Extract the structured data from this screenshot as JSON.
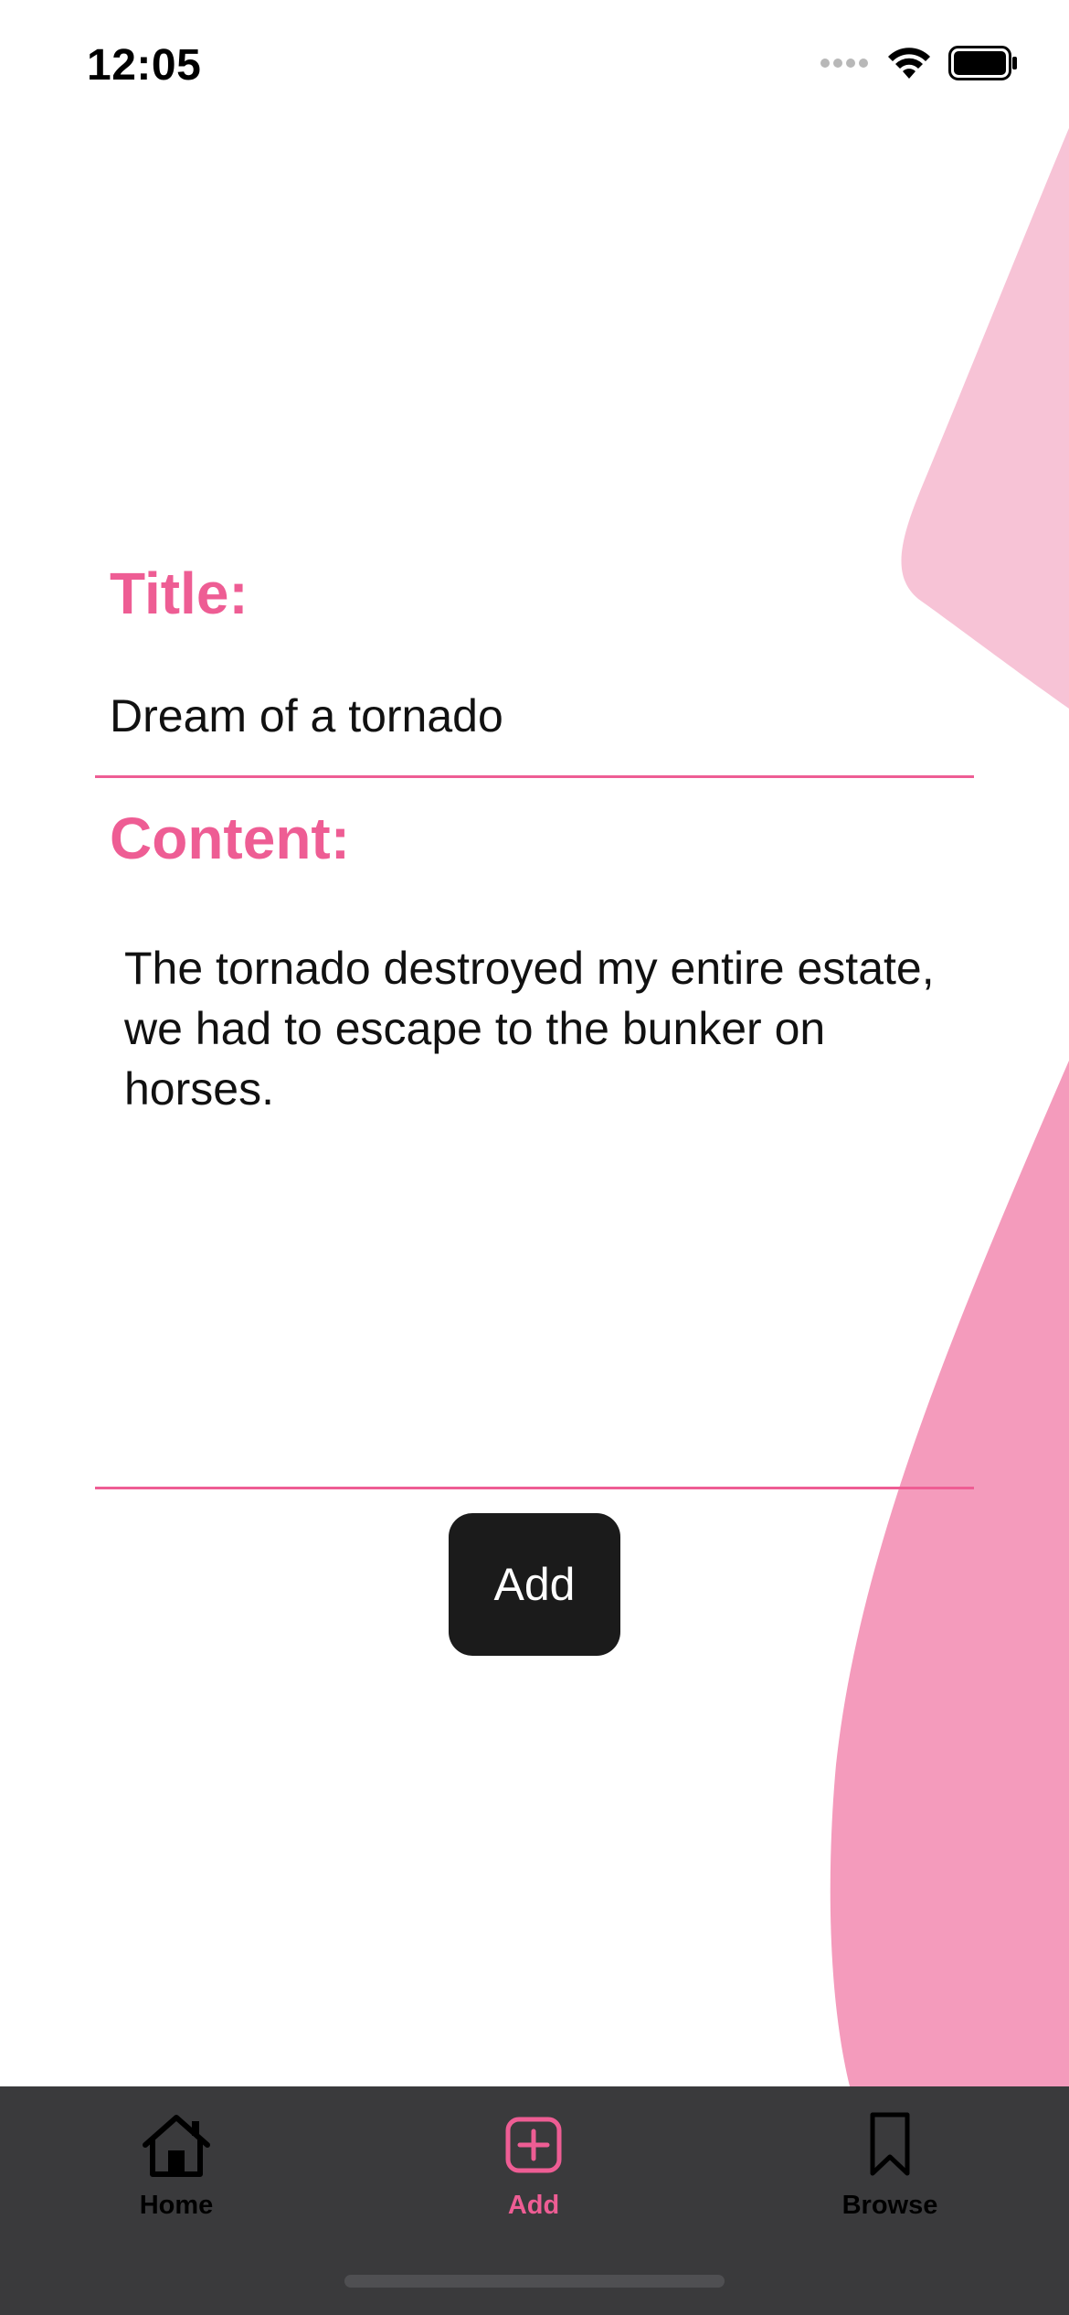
{
  "status_bar": {
    "time": "12:05"
  },
  "colors": {
    "accent": "#ee5d94",
    "blob_light": "#f7c3d6",
    "blob_dark": "#f49bbc",
    "button_bg": "#1b1b1b",
    "tab_bar_bg": "#3a3a3c"
  },
  "form": {
    "title_label": "Title:",
    "title_value": "Dream of a tornado",
    "content_label": "Content:",
    "content_value": "The tornado destroyed my entire estate, we had to escape to the bunker on horses.",
    "submit_label": "Add"
  },
  "tab_bar": {
    "items": [
      {
        "label": "Home",
        "icon": "house-icon",
        "selected": false
      },
      {
        "label": "Add",
        "icon": "plus-square-icon",
        "selected": true
      },
      {
        "label": "Browse",
        "icon": "bookmark-icon",
        "selected": false
      }
    ]
  }
}
